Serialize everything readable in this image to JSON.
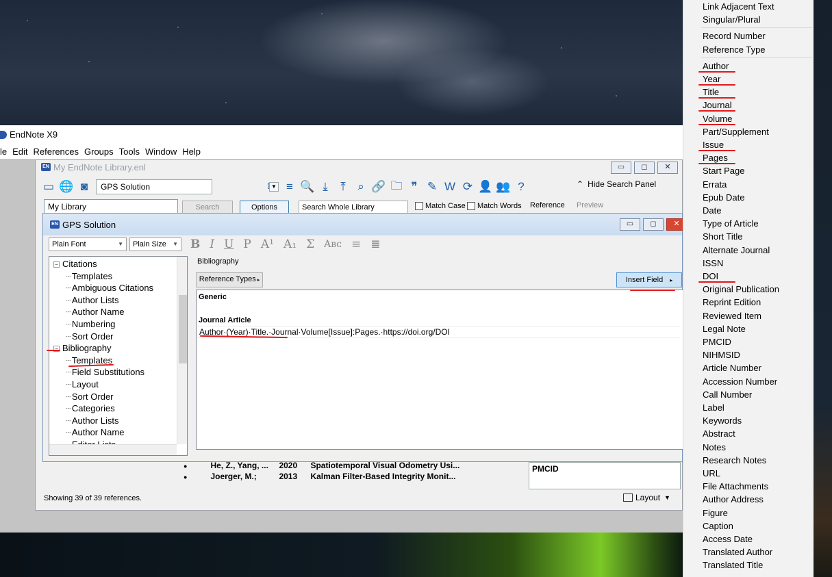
{
  "main_window": {
    "title": "EndNote X9",
    "menu": [
      "le",
      "Edit",
      "References",
      "Groups",
      "Tools",
      "Window",
      "Help"
    ],
    "status": "Showing 39 of 39 references.",
    "layout_label": "Layout"
  },
  "library_window": {
    "title": "My EndNote Library.enl",
    "group_select": "GPS Solution",
    "hide_search": "Hide Search Panel",
    "library_field": "My Library",
    "search_button": "Search",
    "options_button": "Options",
    "search_scope": "Search Whole Library",
    "match_case": "Match Case",
    "match_words": "Match Words",
    "tab_reference": "Reference",
    "tab_preview": "Preview",
    "ref_rows": [
      {
        "author": "He, Z., Yang, ...",
        "year": "2020",
        "title": "Spatiotemporal Visual Odometry Usi..."
      },
      {
        "author": "Joerger, M.;",
        "year": "2013",
        "title": "Kalman Filter-Based Integrity Monit..."
      }
    ],
    "right_field_box": "PMCID"
  },
  "style_dialog": {
    "title": "GPS Solution",
    "font_select": "Plain Font",
    "size_select": "Plain Size",
    "tree": [
      {
        "label": "Citations",
        "level": 0,
        "expander": "−"
      },
      {
        "label": "Templates",
        "level": 1
      },
      {
        "label": "Ambiguous Citations",
        "level": 1
      },
      {
        "label": "Author Lists",
        "level": 1
      },
      {
        "label": "Author Name",
        "level": 1
      },
      {
        "label": "Numbering",
        "level": 1
      },
      {
        "label": "Sort Order",
        "level": 1
      },
      {
        "label": "Bibliography",
        "level": 0,
        "expander": "−"
      },
      {
        "label": "Templates",
        "level": 1
      },
      {
        "label": "Field Substitutions",
        "level": 1
      },
      {
        "label": "Layout",
        "level": 1
      },
      {
        "label": "Sort Order",
        "level": 1
      },
      {
        "label": "Categories",
        "level": 1
      },
      {
        "label": "Author Lists",
        "level": 1
      },
      {
        "label": "Author Name",
        "level": 1
      },
      {
        "label": "Editor Lists",
        "level": 1
      }
    ],
    "editor": {
      "section_label": "Bibliography",
      "reference_types_button": "Reference Types",
      "insert_field_button": "Insert Field",
      "generic_header": "Generic",
      "journal_header": "Journal Article",
      "template_line": "Author·(Year)·Title.·Journal·Volume[Issue]:Pages.·https://doi.org/DOI"
    }
  },
  "field_list": [
    {
      "label": "Link Adjacent Text"
    },
    {
      "label": "Singular/Plural",
      "sep_after": true
    },
    {
      "label": "Record Number"
    },
    {
      "label": "Reference Type",
      "sep_after": true
    },
    {
      "label": "Author",
      "marked": true
    },
    {
      "label": "Year",
      "marked": true
    },
    {
      "label": "Title",
      "marked": true
    },
    {
      "label": "Journal",
      "marked": true
    },
    {
      "label": "Volume",
      "marked": true
    },
    {
      "label": "Part/Supplement"
    },
    {
      "label": "Issue",
      "marked": true
    },
    {
      "label": "Pages",
      "marked": true
    },
    {
      "label": "Start Page"
    },
    {
      "label": "Errata"
    },
    {
      "label": "Epub Date"
    },
    {
      "label": "Date"
    },
    {
      "label": "Type of Article"
    },
    {
      "label": "Short Title"
    },
    {
      "label": "Alternate Journal"
    },
    {
      "label": "ISSN"
    },
    {
      "label": "DOI",
      "marked": true
    },
    {
      "label": "Original Publication"
    },
    {
      "label": "Reprint Edition"
    },
    {
      "label": "Reviewed Item"
    },
    {
      "label": "Legal Note"
    },
    {
      "label": "PMCID"
    },
    {
      "label": "NIHMSID"
    },
    {
      "label": "Article Number"
    },
    {
      "label": "Accession Number"
    },
    {
      "label": "Call Number"
    },
    {
      "label": "Label"
    },
    {
      "label": "Keywords"
    },
    {
      "label": "Abstract"
    },
    {
      "label": "Notes"
    },
    {
      "label": "Research Notes"
    },
    {
      "label": "URL"
    },
    {
      "label": "File Attachments"
    },
    {
      "label": "Author Address"
    },
    {
      "label": "Figure"
    },
    {
      "label": "Caption"
    },
    {
      "label": "Access Date"
    },
    {
      "label": "Translated Author"
    },
    {
      "label": "Translated Title"
    }
  ],
  "colors": {
    "annotation": "#e0191c",
    "accent": "#2a56a8"
  }
}
